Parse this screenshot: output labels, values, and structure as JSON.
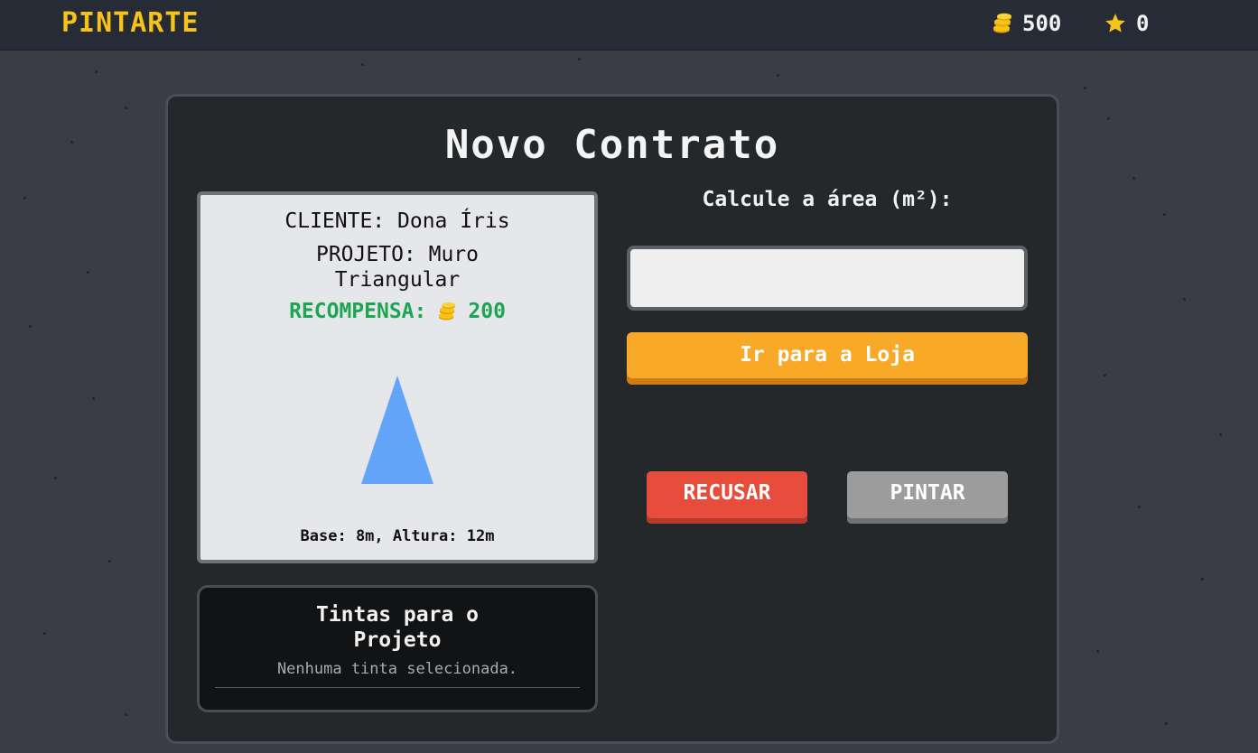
{
  "app": {
    "logo": "PINTARTE",
    "coins": "500",
    "stars": "0",
    "coin_icon": "coin-stack-icon",
    "star_icon": "star-icon"
  },
  "contract": {
    "title": "Novo Contrato",
    "client": "CLIENTE: Dona Íris",
    "project_line1": "PROJETO: Muro",
    "project_line2": "Triangular",
    "reward_label": "RECOMPENSA:",
    "reward_value": "200",
    "dimensions": "Base: 8m, Altura: 12m",
    "shape": "triangle",
    "shape_color": "#62a5f8"
  },
  "paints": {
    "title_line1": "Tintas para o",
    "title_line2": "Projeto",
    "empty_text": "Nenhuma tinta selecionada."
  },
  "actions": {
    "calc_label": "Calcule a área (m²):",
    "area_value": "",
    "shop_button": "Ir para a Loja",
    "refuse_button": "RECUSAR",
    "paint_button": "PINTAR"
  },
  "colors": {
    "accent_yellow": "#f7c31b",
    "reward_green": "#1ea552",
    "shop_orange": "#f8a928",
    "refuse_red": "#e74c3c",
    "paint_gray": "#9c9c9c"
  }
}
